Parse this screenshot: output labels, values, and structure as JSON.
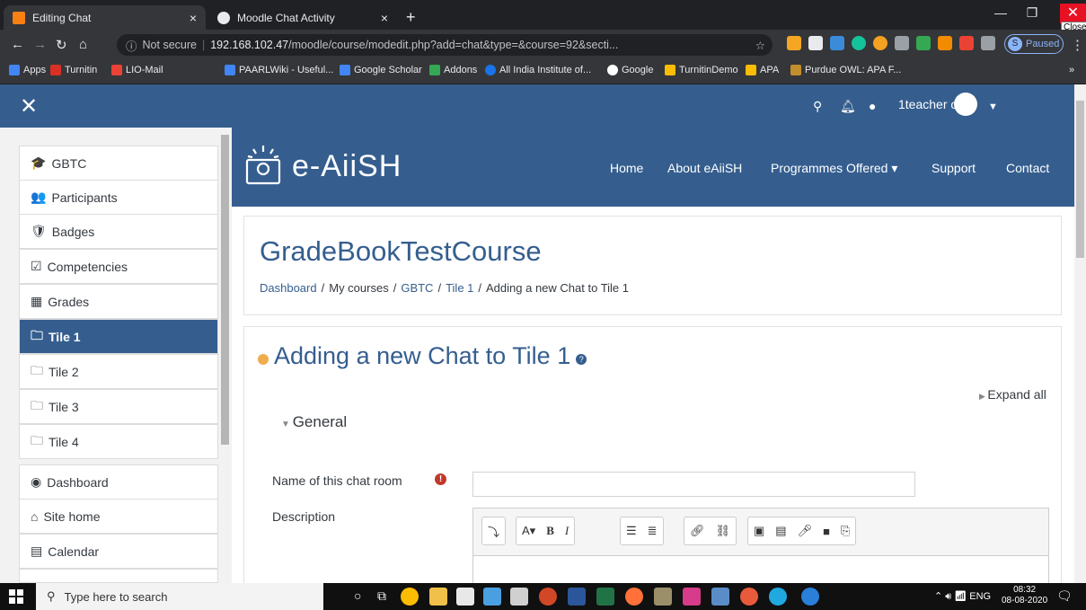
{
  "browser": {
    "tabs": [
      {
        "title": "Editing Chat",
        "close": "×"
      },
      {
        "title": "Moodle Chat Activity",
        "close": "×"
      }
    ],
    "new_tab": "+",
    "url_security": "Not secure",
    "url_host": "192.168.102.47",
    "url_path": "/moodle/course/modedit.php?add=chat&type=&course=92&secti...",
    "profile_status": "Paused",
    "profile_initial": "S",
    "close_tooltip": "Close",
    "bookmarks": [
      "Apps",
      "Turnitin",
      "LIO-Mail",
      "PAARLWiki - Useful...",
      "Google Scholar",
      "Addons",
      "All India Institute of...",
      "Google",
      "TurnitinDemo",
      "APA",
      "Purdue OWL: APA F..."
    ],
    "bookmarks_more": "»"
  },
  "navbar": {
    "close_drawer": "✕",
    "user_name": "1teacher one"
  },
  "drawer": {
    "items": [
      {
        "label": "GBTC",
        "icon": "🎓"
      },
      {
        "label": "Participants",
        "icon": "👥"
      },
      {
        "label": "Badges",
        "icon": "🛡"
      },
      {
        "label": "Competencies",
        "icon": "☑"
      },
      {
        "label": "Grades",
        "icon": "▦"
      },
      {
        "label": "Tile 1",
        "icon": "🗀"
      },
      {
        "label": "Tile 2",
        "icon": "🗀"
      },
      {
        "label": "Tile 3",
        "icon": "🗀"
      },
      {
        "label": "Tile 4",
        "icon": "🗀"
      },
      {
        "label": "Dashboard",
        "icon": "◉"
      },
      {
        "label": "Site home",
        "icon": "⌂"
      },
      {
        "label": "Calendar",
        "icon": "▤"
      }
    ]
  },
  "site": {
    "brand": "e-AiiSH",
    "menu": [
      "Home",
      "About eAiiSH",
      "Programmes Offered ▾",
      "Support",
      "Contact"
    ]
  },
  "page": {
    "course_title": "GradeBookTestCourse",
    "breadcrumb": [
      "Dashboard",
      "My courses",
      "GBTC",
      "Tile 1",
      "Adding a new Chat to Tile 1"
    ],
    "heading": "Adding a new Chat to Tile 1",
    "expand_all": "Expand all",
    "section_general": "General",
    "name_label": "Name of this chat room",
    "name_value": "",
    "desc_label": "Description"
  },
  "taskbar": {
    "search_placeholder": "Type here to search",
    "tray_lang": "ENG",
    "time": "08:32",
    "date": "08-08-2020"
  }
}
